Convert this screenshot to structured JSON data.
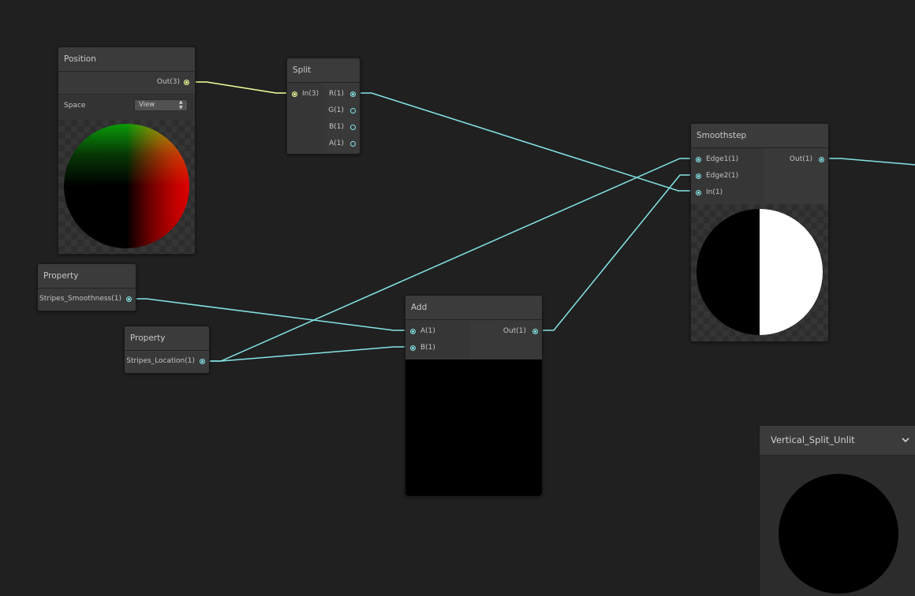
{
  "colors": {
    "canvas_bg": "#202020",
    "node_bg": "#393939",
    "vector1_edge": "#84e4e7",
    "vector3_edge": "#f6ff9a"
  },
  "nodes": {
    "position": {
      "title": "Position",
      "out_label": "Out(3)",
      "space_label": "Space",
      "space_value": "View"
    },
    "split": {
      "title": "Split",
      "in_label": "In(3)",
      "outputs": [
        "R(1)",
        "G(1)",
        "B(1)",
        "A(1)"
      ]
    },
    "smoothstep": {
      "title": "Smoothstep",
      "inputs": [
        "Edge1(1)",
        "Edge2(1)",
        "In(1)"
      ],
      "out_label": "Out(1)"
    },
    "property_smoothness": {
      "title": "Property",
      "out_label": "Stripes_Smoothness(1)"
    },
    "property_location": {
      "title": "Property",
      "out_label": "Stripes_Location(1)"
    },
    "add": {
      "title": "Add",
      "inputs": [
        "A(1)",
        "B(1)"
      ],
      "out_label": "Out(1)"
    },
    "master_preview": {
      "title": "Vertical_Split_Unlit",
      "chevron_icon": "chevron-down-icon"
    }
  }
}
